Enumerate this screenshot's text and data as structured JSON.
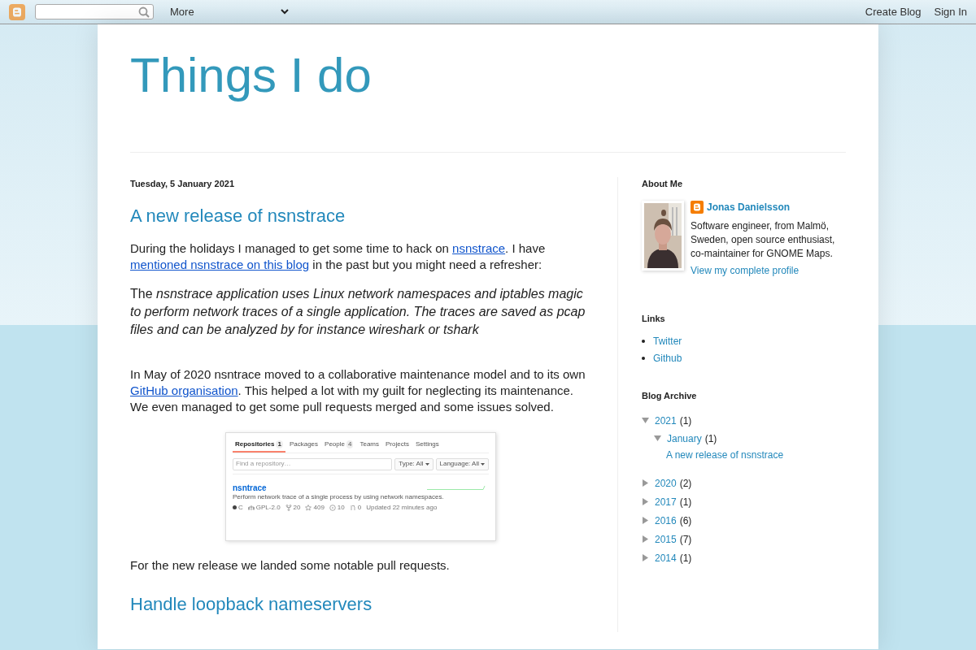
{
  "navbar": {
    "more": "More",
    "actions": [
      "Create Blog",
      "Sign In"
    ]
  },
  "blog_title": "Things I do",
  "post": {
    "date": "Tuesday, 5 January 2021",
    "title": "A new release of nsnstrace",
    "blocks": [
      {
        "kind": "paragraph",
        "segments": [
          {
            "text": "During the holidays I managed to get some time to hack on ",
            "link": false
          },
          {
            "text": "nsnstrace",
            "link": true
          },
          {
            "text": ". I have ",
            "link": false
          },
          {
            "text": "mentioned nsnstrace on this blog",
            "link": true
          },
          {
            "text": " in the past but you might need a refresher:",
            "link": false
          }
        ]
      },
      {
        "kind": "quote",
        "text": "The *nsnstrace application uses Linux network namespaces and iptables magic to perform network traces of a single application. The traces are saved as pcap files and can be analyzed by for instance wireshark or tshark*"
      },
      {
        "kind": "paragraph",
        "segments": [
          {
            "text": "In May of 2020 nsntrace moved to a collaborative maintenance model and to its own ",
            "link": false
          },
          {
            "text": "GitHub organisation",
            "link": true
          },
          {
            "text": ". This helped a lot with my guilt for neglecting its maintenance. We even managed to get some pull requests merged and some issues solved.",
            "link": false
          }
        ]
      },
      {
        "kind": "screenshot"
      },
      {
        "kind": "paragraph",
        "segments": [
          {
            "text": "For the new release we landed some notable pull requests.",
            "link": false
          }
        ]
      },
      {
        "kind": "heading",
        "text": "Handle loopback nameservers"
      }
    ]
  },
  "github_screenshot": {
    "tabs": [
      {
        "label": "Repositories",
        "count": "1",
        "selected": true
      },
      {
        "label": "Packages",
        "selected": false
      },
      {
        "label": "People",
        "count": "4",
        "selected": false
      },
      {
        "label": "Teams",
        "selected": false
      },
      {
        "label": "Projects",
        "selected": false
      },
      {
        "label": "Settings",
        "selected": false
      }
    ],
    "search": {
      "placeholder": "Find a repository…"
    },
    "filters": [
      {
        "label": "Type:",
        "value": "All"
      },
      {
        "label": "Language:",
        "value": "All"
      }
    ],
    "repo": {
      "name": "nsntrace",
      "description": "Perform network trace of a single process by using network namespaces.",
      "language": "C",
      "license": "GPL-2.0",
      "forks": "20",
      "stars": "409",
      "issues": "10",
      "pulls": "0",
      "updated": "Updated 22 minutes ago"
    }
  },
  "sidebar": {
    "about": {
      "heading": "About Me",
      "name": "Jonas Danielsson",
      "bio": "Software engineer, from Malmö, Sweden, open source enthusiast, co-maintainer for GNOME Maps.",
      "profile_link": "View my complete profile"
    },
    "links": {
      "heading": "Links",
      "items": [
        "Twitter",
        "Github"
      ]
    },
    "archive": {
      "heading": "Blog Archive",
      "years": [
        {
          "year": "2021",
          "count": "(1)",
          "expanded": true,
          "children": [
            {
              "month": "January",
              "count": "(1)",
              "expanded": true,
              "posts": [
                "A new release of nsnstrace"
              ]
            }
          ]
        },
        {
          "year": "2020",
          "count": "(2)",
          "expanded": false
        },
        {
          "year": "2017",
          "count": "(1)",
          "expanded": false
        },
        {
          "year": "2016",
          "count": "(6)",
          "expanded": false
        },
        {
          "year": "2015",
          "count": "(7)",
          "expanded": false
        },
        {
          "year": "2014",
          "count": "(1)",
          "expanded": false
        }
      ]
    }
  }
}
